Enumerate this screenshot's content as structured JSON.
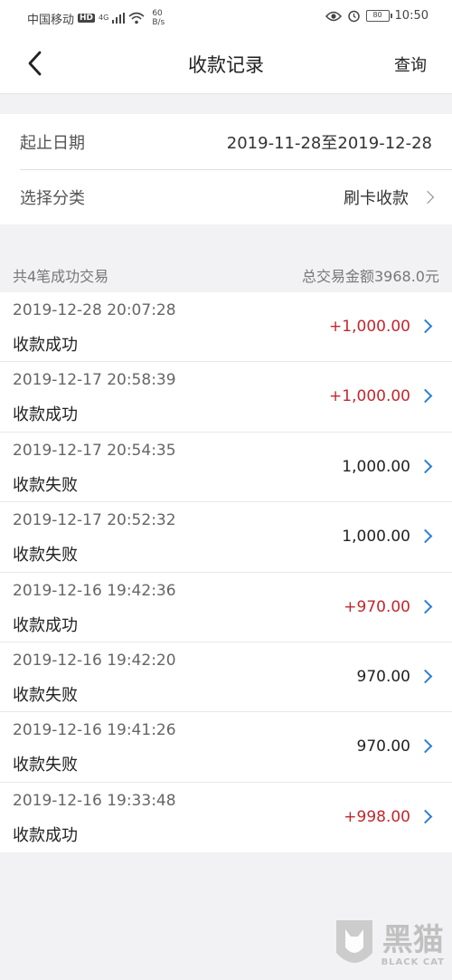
{
  "status_bar": {
    "carrier": "中国移动",
    "hd": "HD",
    "signal_tag": "4G",
    "net_speed_value": "60",
    "net_speed_unit": "B/s",
    "battery": "80",
    "time": "10:50"
  },
  "nav": {
    "title": "收款记录",
    "query_label": "查询"
  },
  "filters": {
    "date_label": "起止日期",
    "date_value": "2019-11-28至2019-12-28",
    "category_label": "选择分类",
    "category_value": "刷卡收款"
  },
  "summary": {
    "count_text": "共4笔成功交易",
    "total_text": "总交易金额3968.0元"
  },
  "records": [
    {
      "time": "2019-12-28 20:07:28",
      "status": "收款成功",
      "amount": "+1,000.00",
      "positive": true
    },
    {
      "time": "2019-12-17 20:58:39",
      "status": "收款成功",
      "amount": "+1,000.00",
      "positive": true
    },
    {
      "time": "2019-12-17 20:54:35",
      "status": "收款失败",
      "amount": "1,000.00",
      "positive": false
    },
    {
      "time": "2019-12-17 20:52:32",
      "status": "收款失败",
      "amount": "1,000.00",
      "positive": false
    },
    {
      "time": "2019-12-16 19:42:36",
      "status": "收款成功",
      "amount": "+970.00",
      "positive": true
    },
    {
      "time": "2019-12-16 19:42:20",
      "status": "收款失败",
      "amount": "970.00",
      "positive": false
    },
    {
      "time": "2019-12-16 19:41:26",
      "status": "收款失败",
      "amount": "970.00",
      "positive": false
    },
    {
      "time": "2019-12-16 19:33:48",
      "status": "收款成功",
      "amount": "+998.00",
      "positive": true
    }
  ],
  "colors": {
    "positive_amount": "#c2272d",
    "chevron": "#2a7fd4",
    "background": "#f2f2f4"
  },
  "watermark": {
    "cn": "黑猫",
    "en": "BLACK CAT"
  }
}
